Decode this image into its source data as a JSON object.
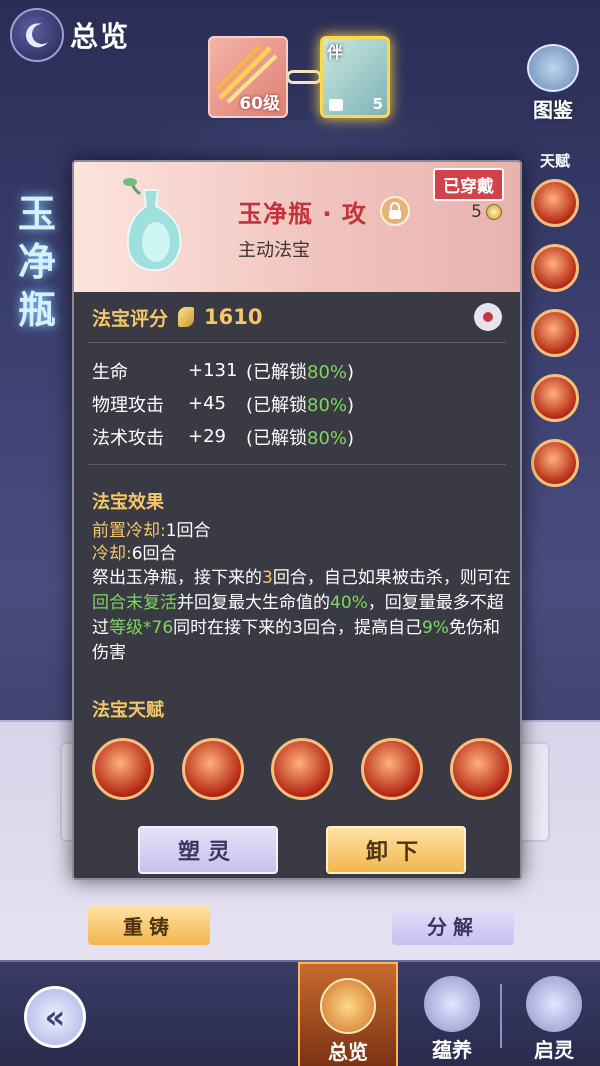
{
  "header": {
    "title": "总览",
    "weapon_level": "60级",
    "companion_mark": "伴",
    "companion_level": "5",
    "atlas_label": "图鉴"
  },
  "side_title": "玉净瓶",
  "talent_column_label": "天赋",
  "popup": {
    "item_name": "玉净瓶 · 攻",
    "item_type": "主动法宝",
    "equipped_badge": "已穿戴",
    "star_level": "5",
    "score_label": "法宝评分",
    "score_value": "1610",
    "stats": [
      {
        "name": "生命",
        "value": "+131",
        "unlock_prefix": "(已解锁",
        "unlock_pct": "80%",
        "unlock_suffix": ")"
      },
      {
        "name": "物理攻击",
        "value": "+45",
        "unlock_prefix": "(已解锁",
        "unlock_pct": "80%",
        "unlock_suffix": ")"
      },
      {
        "name": "法术攻击",
        "value": "+29",
        "unlock_prefix": "(已解锁",
        "unlock_pct": "80%",
        "unlock_suffix": ")"
      }
    ],
    "effect_title": "法宝效果",
    "pre_cooldown_label": "前置冷却:",
    "pre_cooldown_value": "1回合",
    "cooldown_label": "冷却:",
    "cooldown_value": "6回合",
    "desc": {
      "p1": "祭出玉净瓶，接下来的",
      "h1": "3",
      "p2": "回合，自己如果被击杀，则可在",
      "h2": "回合末复活",
      "p3": "并回复最大生命值的",
      "h3": "40%",
      "p4": "，回复量最多不超过",
      "h4": "等级*76",
      "p5": "同时在接下来的3回合，提高自己",
      "h5": "9%",
      "p6": "免伤和伤害"
    },
    "talent_title": "法宝天赋",
    "mold_button": "塑灵",
    "unequip_button": "卸下"
  },
  "lower_buttons": {
    "recast": "重铸",
    "decompose": "分解"
  },
  "bottom_nav": {
    "back_symbol": "«",
    "tabs": [
      {
        "label": "总览"
      },
      {
        "label": "蕴养"
      },
      {
        "label": "启灵"
      }
    ]
  }
}
